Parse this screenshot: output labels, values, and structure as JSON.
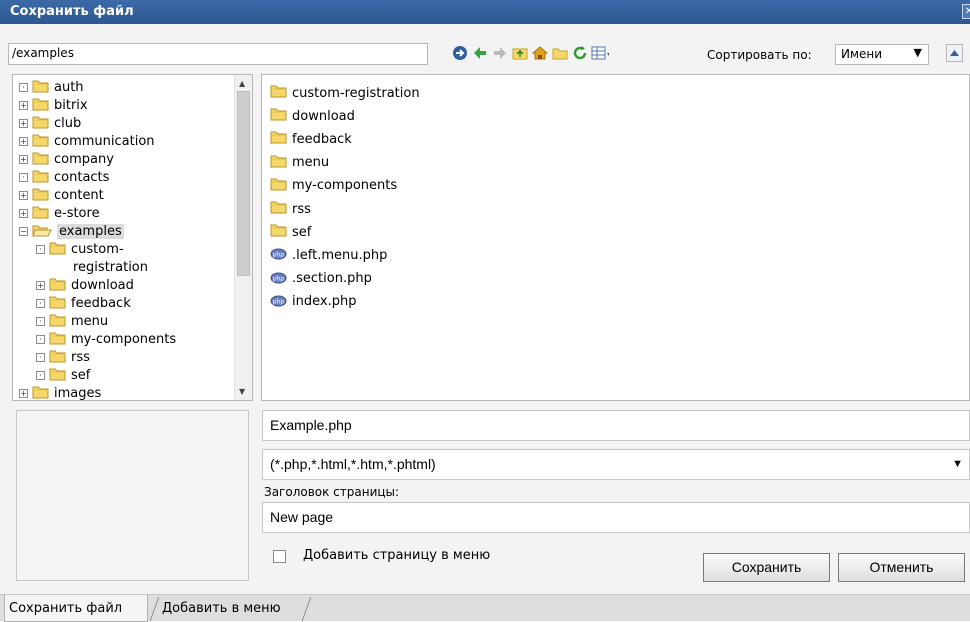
{
  "window": {
    "title": "Сохранить файл"
  },
  "toolbar": {
    "path": "/examples",
    "icons": [
      "go-icon",
      "back-icon",
      "forward-icon",
      "up-folder-icon",
      "home-icon",
      "new-folder-icon",
      "refresh-icon",
      "view-mode-icon"
    ],
    "sort_label": "Сортировать по:",
    "sort_value": "Имени"
  },
  "tree": [
    {
      "label": "auth",
      "expander": "·",
      "indent": 0
    },
    {
      "label": "bitrix",
      "expander": "+",
      "indent": 0
    },
    {
      "label": "club",
      "expander": "+",
      "indent": 0
    },
    {
      "label": "communication",
      "expander": "+",
      "indent": 0
    },
    {
      "label": "company",
      "expander": "+",
      "indent": 0
    },
    {
      "label": "contacts",
      "expander": "·",
      "indent": 0
    },
    {
      "label": "content",
      "expander": "+",
      "indent": 0
    },
    {
      "label": "e-store",
      "expander": "+",
      "indent": 0
    },
    {
      "label": "examples",
      "expander": "−",
      "indent": 0,
      "selected": true,
      "open": true
    },
    {
      "label": "custom-",
      "expander": "·",
      "indent": 1
    },
    {
      "label": "registration",
      "expander": "",
      "indent": 2
    },
    {
      "label": "download",
      "expander": "+",
      "indent": 1
    },
    {
      "label": "feedback",
      "expander": "·",
      "indent": 1
    },
    {
      "label": "menu",
      "expander": "·",
      "indent": 1
    },
    {
      "label": "my-components",
      "expander": "·",
      "indent": 1
    },
    {
      "label": "rss",
      "expander": "·",
      "indent": 1
    },
    {
      "label": "sef",
      "expander": "·",
      "indent": 1
    },
    {
      "label": "images",
      "expander": "+",
      "indent": 0
    }
  ],
  "files": [
    {
      "name": "custom-registration",
      "type": "folder"
    },
    {
      "name": "download",
      "type": "folder"
    },
    {
      "name": "feedback",
      "type": "folder"
    },
    {
      "name": "menu",
      "type": "folder"
    },
    {
      "name": "my-components",
      "type": "folder"
    },
    {
      "name": "rss",
      "type": "folder"
    },
    {
      "name": "sef",
      "type": "folder"
    },
    {
      "name": ".left.menu.php",
      "type": "php"
    },
    {
      "name": ".section.php",
      "type": "php"
    },
    {
      "name": "index.php",
      "type": "php"
    }
  ],
  "form": {
    "filename": "Example.php",
    "filetype": "(*.php,*.html,*.htm,*.phtml)",
    "page_title_label": "Заголовок страницы:",
    "page_title": "New page",
    "add_to_menu_label": "Добавить страницу в меню",
    "save_label": "Сохранить",
    "cancel_label": "Отменить"
  },
  "tabs": [
    "Сохранить файл",
    "Добавить в меню"
  ],
  "colors": {
    "titlebar": "#2c5790",
    "folder": "#f6d86a",
    "selection": "#dcdcdc"
  }
}
